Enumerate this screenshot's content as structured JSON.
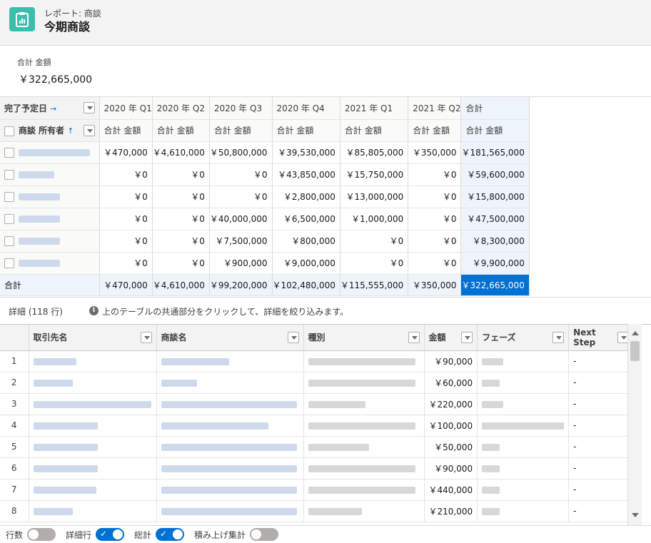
{
  "header": {
    "subtitle": "レポート: 商談",
    "title": "今期商談"
  },
  "summary": {
    "label": "合計 金額",
    "value": "￥322,665,000"
  },
  "matrix": {
    "corner_top": "完了予定日",
    "corner_bottom": "商談 所有者",
    "columns": [
      "2020 年 Q1",
      "2020 年 Q2",
      "2020 年 Q3",
      "2020 年 Q4",
      "2021 年 Q1",
      "2021 年 Q2",
      "合計"
    ],
    "subheader": "合計 金額",
    "rows": [
      [
        "￥470,000",
        "￥4,610,000",
        "￥50,800,000",
        "￥39,530,000",
        "￥85,805,000",
        "￥350,000",
        "￥181,565,000"
      ],
      [
        "￥0",
        "￥0",
        "￥0",
        "￥43,850,000",
        "￥15,750,000",
        "￥0",
        "￥59,600,000"
      ],
      [
        "￥0",
        "￥0",
        "￥0",
        "￥2,800,000",
        "￥13,000,000",
        "￥0",
        "￥15,800,000"
      ],
      [
        "￥0",
        "￥0",
        "￥40,000,000",
        "￥6,500,000",
        "￥1,000,000",
        "￥0",
        "￥47,500,000"
      ],
      [
        "￥0",
        "￥0",
        "￥7,500,000",
        "￥800,000",
        "￥0",
        "￥0",
        "￥8,300,000"
      ],
      [
        "￥0",
        "￥0",
        "￥900,000",
        "￥9,000,000",
        "￥0",
        "￥0",
        "￥9,900,000"
      ]
    ],
    "total_label": "合計",
    "totals": [
      "￥470,000",
      "￥4,610,000",
      "￥99,200,000",
      "￥102,480,000",
      "￥115,555,000",
      "￥350,000",
      "￥322,665,000"
    ]
  },
  "details": {
    "title": "詳細 (118 行)",
    "info": "上のテーブルの共通部分をクリックして、詳細を絞り込みます。",
    "columns": [
      "取引先名",
      "商談名",
      "種別",
      "金額",
      "フェーズ",
      "Next Step"
    ],
    "rows": [
      {
        "num": "1",
        "amount": "￥90,000",
        "next": "-"
      },
      {
        "num": "2",
        "amount": "￥60,000",
        "next": "-"
      },
      {
        "num": "3",
        "amount": "￥220,000",
        "next": "-"
      },
      {
        "num": "4",
        "amount": "￥100,000",
        "next": "-"
      },
      {
        "num": "5",
        "amount": "￥50,000",
        "next": "-"
      },
      {
        "num": "6",
        "amount": "￥90,000",
        "next": "-"
      },
      {
        "num": "7",
        "amount": "￥440,000",
        "next": "-"
      },
      {
        "num": "8",
        "amount": "￥210,000",
        "next": "-"
      }
    ]
  },
  "footer": {
    "toggles": [
      {
        "label": "行数",
        "on": false
      },
      {
        "label": "詳細行",
        "on": true
      },
      {
        "label": "総計",
        "on": true
      },
      {
        "label": "積み上げ集計",
        "on": false
      }
    ]
  },
  "colors": {
    "accent": "#0070d2",
    "icon_bg": "#3bbfad"
  }
}
